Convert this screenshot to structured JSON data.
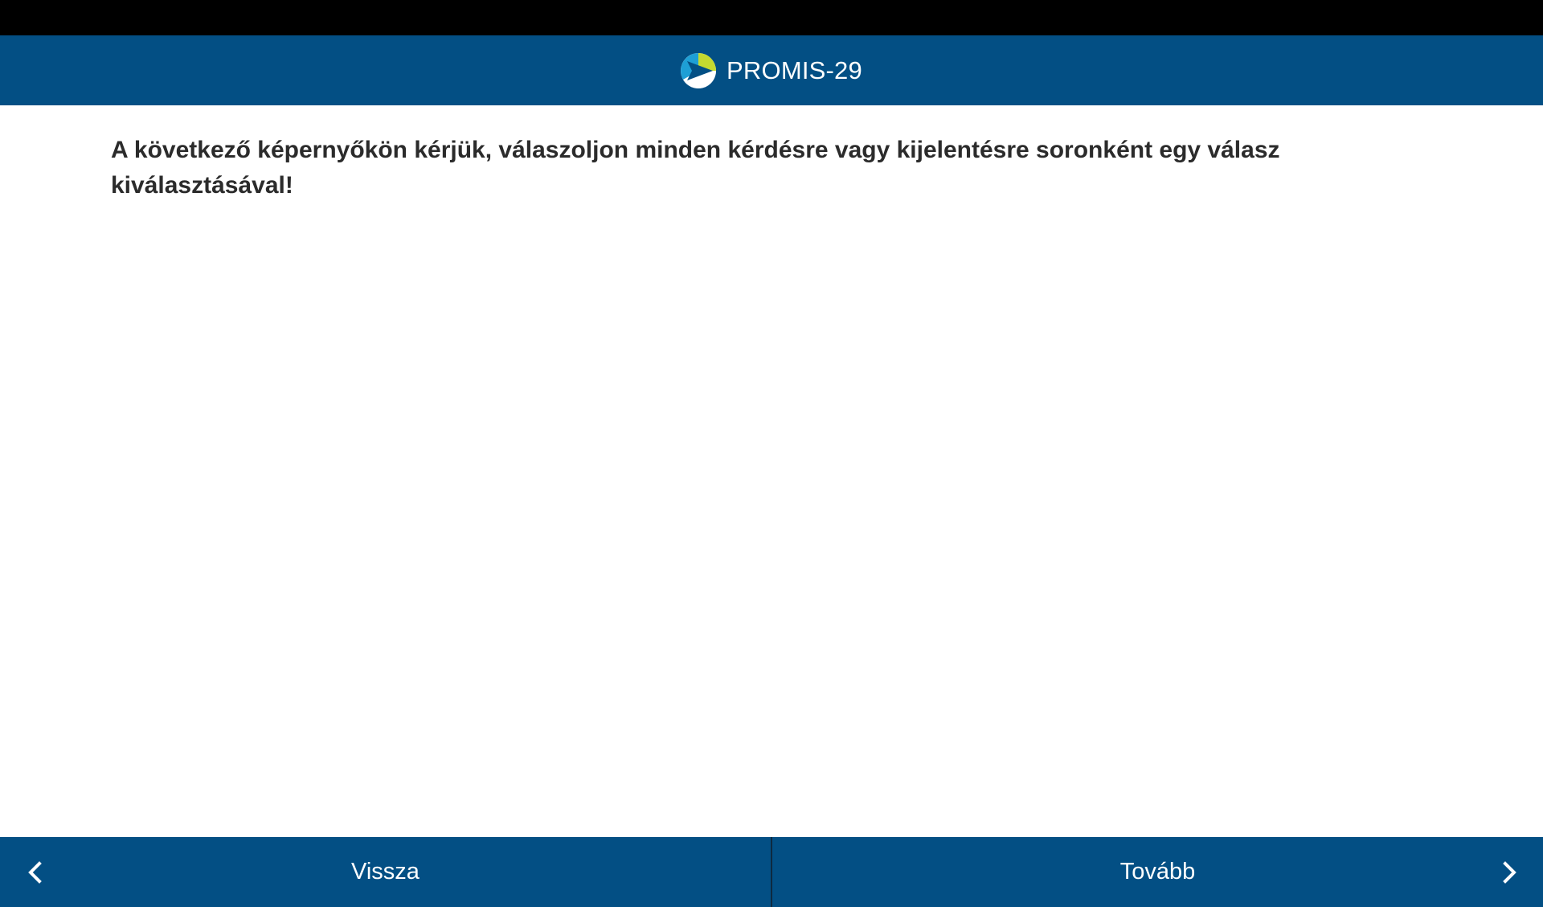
{
  "header": {
    "title": "PROMIS-29",
    "logo_icon": "promis-logo-icon"
  },
  "main": {
    "instruction": "A következő képernyőkön kérjük, válaszoljon minden kérdésre vagy kijelentésre soronként egy válasz kiválasztásával!"
  },
  "footer": {
    "back_label": "Vissza",
    "back_icon": "chevron-left-icon",
    "next_label": "Tovább",
    "next_icon": "chevron-right-icon"
  },
  "colors": {
    "header_bg": "#034f84",
    "status_bar": "#000000",
    "text": "#2b2b2b",
    "logo_green": "#c4d930",
    "logo_blue": "#1e9fd6"
  }
}
